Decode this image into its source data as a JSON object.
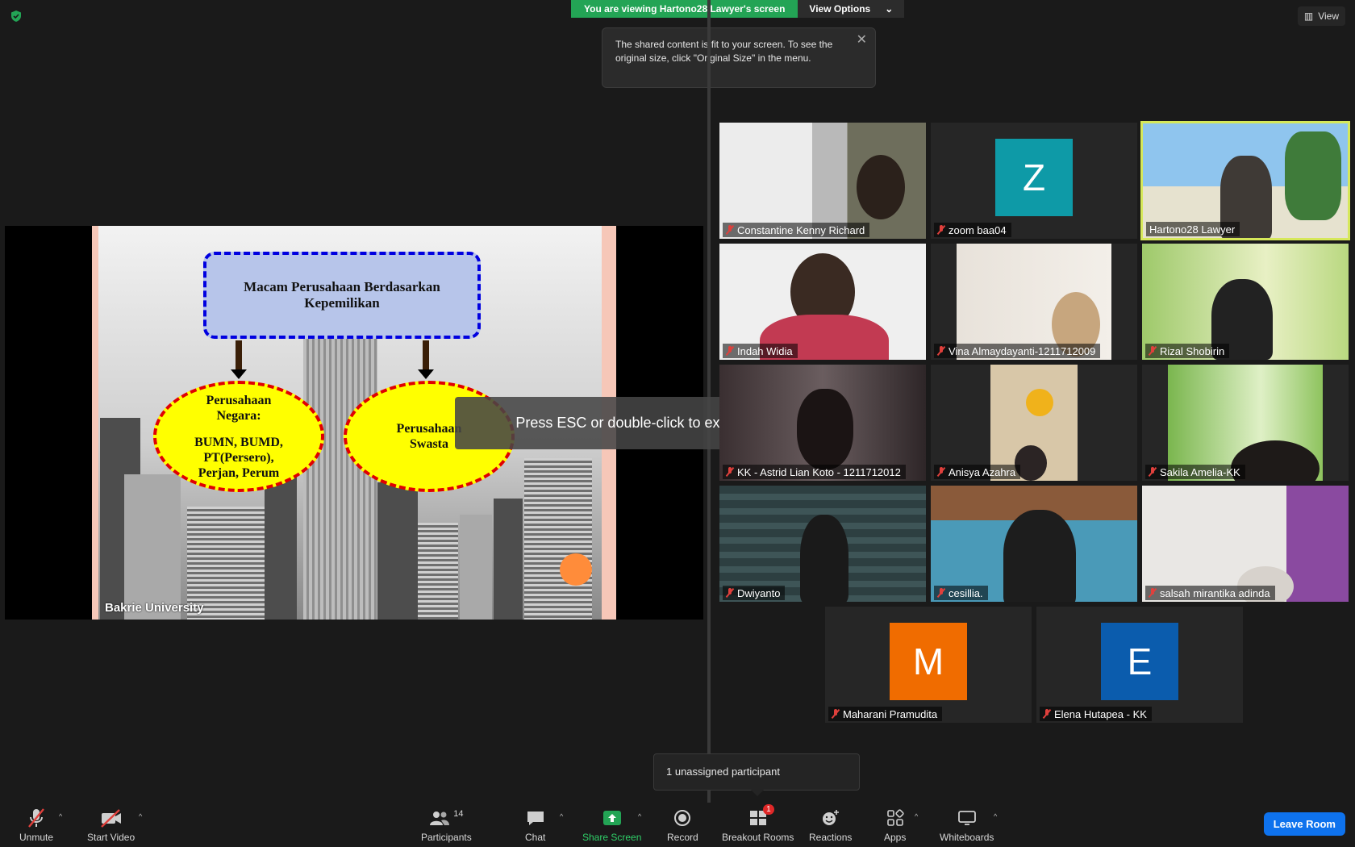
{
  "top": {
    "viewing_text": "You are viewing Hartono28 Lawyer's screen",
    "view_options": "View Options",
    "view_button": "View"
  },
  "tooltip": {
    "text": "The shared content is fit to your screen. To see the original size, click \"Original Size\" in the menu."
  },
  "slide": {
    "title": "Macam Perusahaan Berdasarkan Kepemilikan",
    "left_oval_line1": "Perusahaan",
    "left_oval_line2": "Negara:",
    "left_oval_line3": "BUMN, BUMD,",
    "left_oval_line4": "PT(Persero),",
    "left_oval_line5": "Perjan, Perum",
    "right_oval_line1": "Perusahaan",
    "right_oval_line2": "Swasta",
    "footer": "Bakrie  University"
  },
  "fullscreen_message": "Press ESC or double-click to exit full screen mode",
  "participants": [
    {
      "name": "Constantine Kenny Richard"
    },
    {
      "name": "zoom baa04",
      "initial": "Z",
      "color": "#0e9aa7"
    },
    {
      "name": "Hartono28 Lawyer"
    },
    {
      "name": "Indah Widia"
    },
    {
      "name": "Vina Almaydayanti-1211712009"
    },
    {
      "name": "Rizal Shobirin"
    },
    {
      "name": "KK - Astrid Lian Koto - 1211712012"
    },
    {
      "name": "Anisya Azahra"
    },
    {
      "name": "Sakila Amelia-KK"
    },
    {
      "name": "Dwiyanto"
    },
    {
      "name": "cesillia."
    },
    {
      "name": "salsah mirantika adinda"
    },
    {
      "name": "Maharani Pramudita",
      "initial": "M",
      "color": "#f06c00"
    },
    {
      "name": "Elena Hutapea - KK",
      "initial": "E",
      "color": "#0b5cad"
    }
  ],
  "unassigned": "1 unassigned participant",
  "toolbar": {
    "unmute": "Unmute",
    "start_video": "Start Video",
    "participants": "Participants",
    "participants_count": "14",
    "chat": "Chat",
    "share_screen": "Share Screen",
    "record": "Record",
    "breakout_rooms": "Breakout Rooms",
    "breakout_badge": "1",
    "reactions": "Reactions",
    "apps": "Apps",
    "whiteboards": "Whiteboards",
    "leave_room": "Leave Room"
  },
  "colors": {
    "accent_green": "#23a455",
    "leave_blue": "#0e72ed",
    "active_speaker": "#d6e85a"
  }
}
